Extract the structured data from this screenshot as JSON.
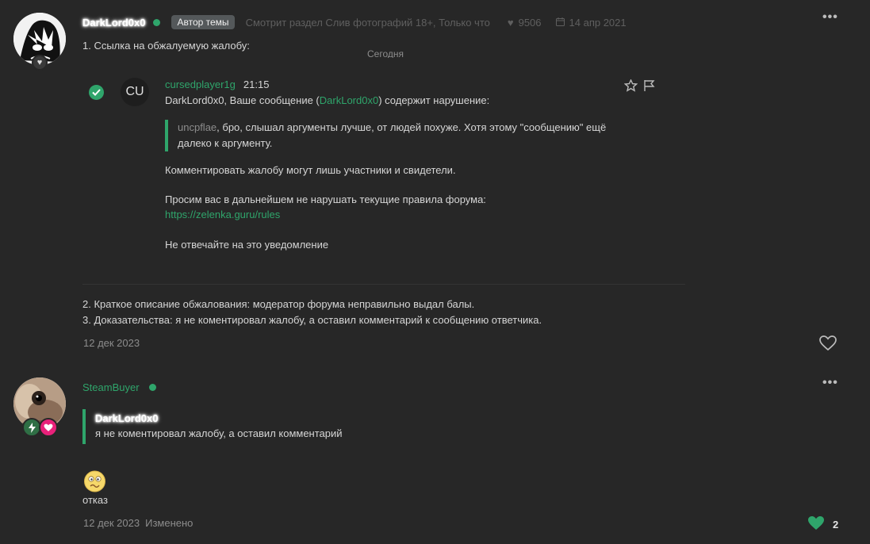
{
  "post1": {
    "author": "DarkLord0x0",
    "badge": "Автор темы",
    "viewing": "Смотрит раздел Слив фотографий 18+, Только что",
    "likes_count": "9506",
    "reg_date": "14 апр 2021",
    "line1": "1. Ссылка на обжалуемую жалобу:",
    "today_label": "Сегодня",
    "embed": {
      "avatar_initials": "CU",
      "username": "cursedplayer1g",
      "time": "21:15",
      "line_pre": "DarkLord0x0, Ваше сообщение (",
      "line_link": "DarkLord0x0",
      "line_post": ") содержит нарушение:",
      "quote_name": "uncpflae",
      "quote_text_1": ", бро, слышал аргументы лучше, от людей похуже. Хотя этому \"сообщению\" ещё",
      "quote_text_2": "далеко к аргументу.",
      "para1": "Комментировать жалобу могут лишь участники и свидетели.",
      "para2": "Просим вас в дальнейшем не нарушать текущие правила форума:",
      "rules_link": "https://zelenka.guru/rules",
      "para3": "Не отвечайте на это уведомление"
    },
    "line2": "2. Краткое описание обжалования: модератор форума неправильно выдал балы.",
    "line3": "3. Доказательства: я не коментировал жалобу, а оставил комментарий к сообщению ответчика.",
    "date": "12 дек 2023"
  },
  "post2": {
    "author": "SteamBuyer",
    "quote_author": "DarkLord0x0",
    "quote_text": "я не коментировал жалобу, а оставил комментарий",
    "reply_text": "отказ",
    "date": "12 дек 2023",
    "edited": "Изменено",
    "likes": "2"
  },
  "icons": {
    "more": "more-dots-icon",
    "heart": "heart-icon",
    "star": "star-icon",
    "flag": "flag-icon",
    "check": "check-circle-icon",
    "calendar": "calendar-icon",
    "lightning": "lightning-icon",
    "emoji": "confused-emoji-icon"
  },
  "colors": {
    "background": "#272727",
    "accent": "#2fa56b",
    "text": "#d6d6d6",
    "muted": "#8c8c8c"
  }
}
